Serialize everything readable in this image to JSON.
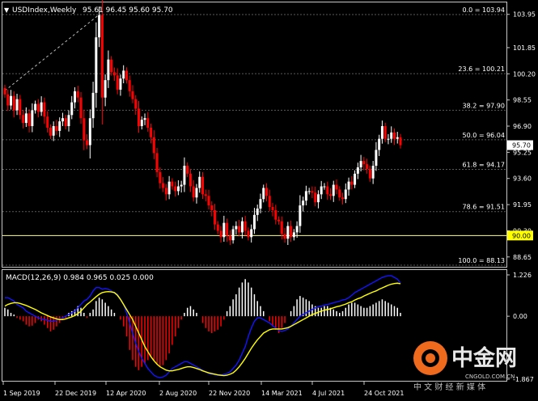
{
  "header": {
    "symbol_label": "USDIndex,Weekly",
    "ohlc_label": "95.61 96.45 95.60 95.70"
  },
  "colors": {
    "background": "#000000",
    "frame": "#c8c8c8",
    "grid": "#5a5a5a",
    "candle_up": "#ffffff",
    "candle_down": "#ff0000",
    "macd_line": "#1414ff",
    "signal_line": "#ffff00",
    "hist_up": "#ffffff",
    "hist_down": "#ff0000",
    "price_marker_bg": "#ffffff",
    "price_marker_text": "#000000",
    "level_marker_bg": "#ffff00",
    "level_line": "#ffff99",
    "watermark_orange": "#f06a1e"
  },
  "price_axis": {
    "ticks": [
      "103.95",
      "101.85",
      "100.20",
      "98.55",
      "96.90",
      "95.25",
      "93.60",
      "91.95",
      "90.30",
      "88.65"
    ],
    "current_price_label": "95.70",
    "level_label": "90.00"
  },
  "fibonacci": [
    {
      "label": "0.0 = 103.94",
      "value": 103.94
    },
    {
      "label": "23.6 = 100.21",
      "value": 100.21
    },
    {
      "label": "38.2 = 97.90",
      "value": 97.9
    },
    {
      "label": "50.0 = 96.04",
      "value": 96.04
    },
    {
      "label": "61.8 = 94.17",
      "value": 94.17
    },
    {
      "label": "78.6 = 91.51",
      "value": 91.51
    },
    {
      "label": "100.0 = 88.13",
      "value": 88.13
    }
  ],
  "horizontal_line": {
    "value": 90.0
  },
  "macd": {
    "label": "MACD(12,26,9) 0.984 0.965 0.025 0.000",
    "axis_ticks": [
      "1.226",
      "0.00",
      "-1.867"
    ]
  },
  "time_axis": {
    "labels": [
      "1 Sep 2019",
      "22 Dec 2019",
      "12 Apr 2020",
      "2 Aug 2020",
      "22 Nov 2020",
      "14 Mar 2021",
      "4 Jul 2021",
      "24 Oct 2021"
    ]
  },
  "watermark": {
    "name": "中金网",
    "domain": "CNGOLD.COM.CN",
    "slogan": "中 文 财 经 新 媒 体"
  },
  "chart_data": {
    "type": "candlestick",
    "ylim": [
      88.13,
      104.6
    ],
    "closes": [
      98.9,
      98.2,
      98.8,
      97.9,
      98.6,
      97.6,
      97.1,
      97.7,
      96.9,
      97.9,
      98.3,
      97.8,
      98.4,
      97.5,
      96.8,
      96.3,
      96.9,
      96.6,
      97.2,
      97.4,
      96.9,
      97.6,
      98.4,
      99.1,
      98.7,
      97.4,
      96.0,
      95.7,
      97.4,
      99.0,
      102.5,
      103.9,
      98.7,
      99.8,
      101.1,
      100.3,
      100.1,
      99.2,
      99.9,
      100.4,
      99.8,
      99.1,
      98.6,
      98.0,
      96.9,
      97.3,
      97.4,
      96.8,
      96.2,
      95.2,
      94.0,
      93.3,
      93.0,
      92.6,
      93.4,
      93.1,
      92.8,
      93.1,
      93.2,
      94.4,
      93.9,
      93.1,
      92.4,
      93.0,
      93.7,
      92.6,
      92.5,
      91.9,
      91.6,
      90.7,
      90.3,
      89.9,
      90.8,
      90.0,
      89.7,
      90.4,
      90.6,
      90.2,
      90.9,
      90.3,
      89.9,
      90.4,
      91.3,
      91.7,
      92.3,
      93.0,
      92.5,
      91.8,
      91.6,
      91.0,
      90.9,
      90.1,
      89.8,
      90.6,
      89.9,
      90.2,
      90.6,
      91.9,
      92.2,
      92.8,
      92.8,
      92.7,
      92.1,
      92.6,
      93.1,
      93.1,
      92.6,
      92.5,
      93.2,
      92.9,
      92.4,
      92.3,
      92.9,
      93.4,
      93.2,
      93.9,
      94.3,
      94.7,
      94.5,
      94.2,
      93.6,
      94.4,
      95.4,
      96.1,
      96.9,
      96.1,
      96.1,
      96.5,
      96.1,
      96.2,
      95.7
    ],
    "macd_hist": [
      0.25,
      0.2,
      0.1,
      0.05,
      -0.05,
      -0.1,
      -0.15,
      -0.25,
      -0.3,
      -0.28,
      -0.2,
      -0.1,
      -0.15,
      -0.25,
      -0.35,
      -0.45,
      -0.4,
      -0.3,
      -0.2,
      -0.1,
      -0.05,
      0.1,
      0.15,
      0.2,
      0.3,
      0.25,
      0.1,
      -0.05,
      0.1,
      0.2,
      0.45,
      0.55,
      0.5,
      0.4,
      0.3,
      0.2,
      0.1,
      0.0,
      -0.1,
      -0.3,
      -0.6,
      -1.0,
      -1.3,
      -1.5,
      -1.6,
      -1.5,
      -1.4,
      -1.3,
      -1.2,
      -1.3,
      -1.4,
      -1.5,
      -1.45,
      -1.3,
      -1.1,
      -0.85,
      -0.6,
      -0.35,
      -0.1,
      0.1,
      0.25,
      0.3,
      0.2,
      0.1,
      0.0,
      -0.2,
      -0.35,
      -0.45,
      -0.5,
      -0.45,
      -0.4,
      -0.3,
      -0.1,
      0.15,
      0.3,
      0.5,
      0.65,
      0.85,
      1.0,
      1.1,
      1.0,
      0.85,
      0.65,
      0.45,
      0.3,
      0.15,
      0.0,
      -0.15,
      -0.3,
      -0.4,
      -0.5,
      -0.35,
      -0.2,
      0.0,
      0.15,
      0.3,
      0.5,
      0.6,
      0.55,
      0.5,
      0.45,
      0.35,
      0.3,
      0.25,
      0.25,
      0.3,
      0.3,
      0.25,
      0.2,
      0.15,
      0.1,
      0.15,
      0.25,
      0.35,
      0.4,
      0.4,
      0.35,
      0.3,
      0.25,
      0.25,
      0.3,
      0.35,
      0.4,
      0.45,
      0.5,
      0.45,
      0.4,
      0.35,
      0.3,
      0.25,
      0.1
    ],
    "macd_line": [
      0.55,
      0.55,
      0.5,
      0.45,
      0.35,
      0.3,
      0.25,
      0.15,
      0.1,
      0.05,
      0.0,
      -0.05,
      -0.08,
      -0.1,
      -0.12,
      -0.15,
      -0.15,
      -0.12,
      -0.08,
      -0.05,
      0.0,
      0.05,
      0.1,
      0.15,
      0.25,
      0.35,
      0.45,
      0.5,
      0.6,
      0.75,
      0.85,
      0.85,
      0.8,
      0.82,
      0.8,
      0.75,
      0.7,
      0.65,
      0.5,
      0.35,
      0.1,
      -0.2,
      -0.5,
      -0.8,
      -1.05,
      -1.25,
      -1.4,
      -1.55,
      -1.65,
      -1.75,
      -1.8,
      -1.82,
      -1.8,
      -1.75,
      -1.65,
      -1.55,
      -1.5,
      -1.45,
      -1.4,
      -1.35,
      -1.35,
      -1.4,
      -1.45,
      -1.5,
      -1.55,
      -1.6,
      -1.65,
      -1.7,
      -1.72,
      -1.74,
      -1.75,
      -1.75,
      -1.72,
      -1.7,
      -1.65,
      -1.55,
      -1.45,
      -1.3,
      -1.1,
      -0.9,
      -0.6,
      -0.35,
      -0.15,
      -0.05,
      -0.05,
      -0.1,
      -0.15,
      -0.2,
      -0.28,
      -0.35,
      -0.42,
      -0.45,
      -0.42,
      -0.38,
      -0.3,
      -0.2,
      -0.1,
      0.0,
      0.05,
      0.1,
      0.15,
      0.2,
      0.25,
      0.28,
      0.3,
      0.33,
      0.35,
      0.37,
      0.4,
      0.42,
      0.45,
      0.48,
      0.5,
      0.55,
      0.62,
      0.7,
      0.75,
      0.8,
      0.85,
      0.9,
      0.95,
      1.0,
      1.05,
      1.1,
      1.15,
      1.18,
      1.2,
      1.2,
      1.15,
      1.1,
      0.98
    ],
    "signal_line": [
      0.3,
      0.35,
      0.38,
      0.4,
      0.4,
      0.38,
      0.35,
      0.32,
      0.28,
      0.24,
      0.2,
      0.15,
      0.1,
      0.06,
      0.02,
      -0.02,
      -0.05,
      -0.08,
      -0.1,
      -0.1,
      -0.08,
      -0.05,
      -0.02,
      0.02,
      0.08,
      0.15,
      0.25,
      0.35,
      0.42,
      0.5,
      0.58,
      0.65,
      0.7,
      0.72,
      0.73,
      0.72,
      0.7,
      0.62,
      0.5,
      0.35,
      0.2,
      0.05,
      -0.1,
      -0.3,
      -0.5,
      -0.7,
      -0.9,
      -1.05,
      -1.2,
      -1.32,
      -1.42,
      -1.5,
      -1.55,
      -1.6,
      -1.62,
      -1.62,
      -1.6,
      -1.58,
      -1.55,
      -1.52,
      -1.5,
      -1.5,
      -1.52,
      -1.55,
      -1.58,
      -1.62,
      -1.65,
      -1.68,
      -1.7,
      -1.72,
      -1.74,
      -1.75,
      -1.76,
      -1.75,
      -1.72,
      -1.68,
      -1.6,
      -1.5,
      -1.38,
      -1.25,
      -1.1,
      -0.95,
      -0.82,
      -0.7,
      -0.6,
      -0.5,
      -0.45,
      -0.4,
      -0.38,
      -0.38,
      -0.38,
      -0.38,
      -0.36,
      -0.34,
      -0.3,
      -0.25,
      -0.2,
      -0.15,
      -0.1,
      -0.05,
      0.0,
      0.05,
      0.08,
      0.12,
      0.15,
      0.18,
      0.2,
      0.22,
      0.25,
      0.28,
      0.3,
      0.33,
      0.36,
      0.4,
      0.43,
      0.48,
      0.52,
      0.55,
      0.6,
      0.64,
      0.68,
      0.72,
      0.75,
      0.8,
      0.84,
      0.88,
      0.92,
      0.95,
      0.97,
      0.98,
      0.965
    ],
    "macd_ylim": [
      -1.867,
      1.226
    ]
  }
}
